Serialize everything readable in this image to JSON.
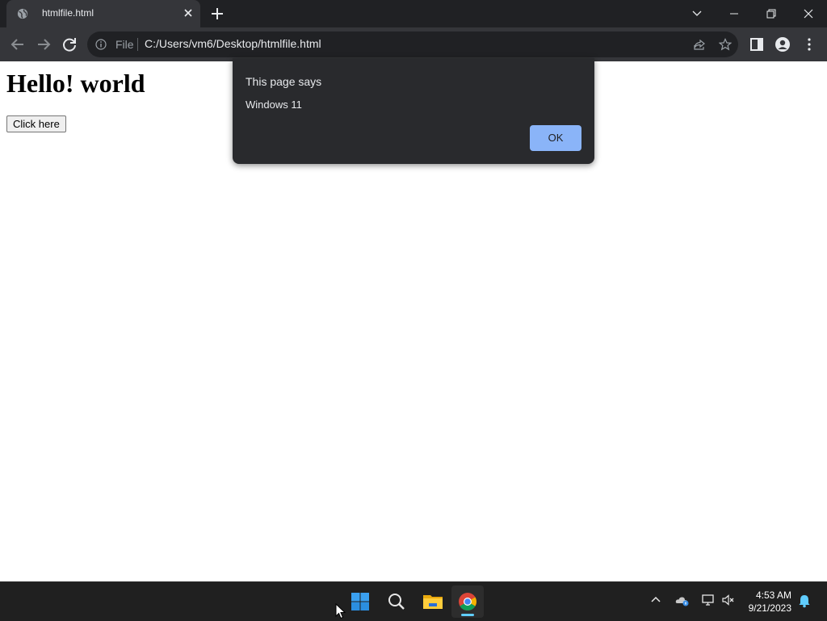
{
  "browser": {
    "tab": {
      "title": "htmlfile.html"
    },
    "omnibox": {
      "scheme_label": "File",
      "url": "C:/Users/vm6/Desktop/htmlfile.html"
    }
  },
  "page": {
    "heading": "Hello! world",
    "button_label": "Click here"
  },
  "dialog": {
    "title": "This page says",
    "message": "Windows 11",
    "ok_label": "OK"
  },
  "taskbar": {
    "time": "4:53 AM",
    "date": "9/21/2023"
  },
  "colors": {
    "accent": "#8ab4f8",
    "taskbar_indicator": "#60cdff"
  }
}
